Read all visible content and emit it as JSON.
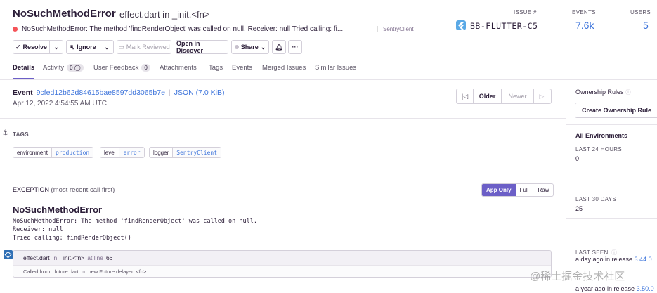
{
  "header": {
    "error_type": "NoSuchMethodError",
    "location": "effect.dart in _init.<fn>",
    "message": "NoSuchMethodError: The method 'findRenderObject' was called on null. Receiver: null Tried calling: fi...",
    "logger": "SentryClient",
    "issue_label": "ISSUE #",
    "issue_id": "BB-FLUTTER-C5",
    "events_label": "EVENTS",
    "events_value": "7.6k",
    "users_label": "USERS",
    "users_value": "5"
  },
  "toolbar": {
    "resolve": "Resolve",
    "ignore": "Ignore",
    "mark_reviewed": "Mark Reviewed",
    "open_discover": "Open in Discover",
    "share": "Share",
    "more": "···"
  },
  "tabs": [
    {
      "label": "Details"
    },
    {
      "label": "Activity",
      "count": "0"
    },
    {
      "label": "User Feedback",
      "count": "0"
    },
    {
      "label": "Attachments"
    },
    {
      "label": "Tags"
    },
    {
      "label": "Events"
    },
    {
      "label": "Merged Issues"
    },
    {
      "label": "Similar Issues"
    }
  ],
  "event": {
    "label": "Event",
    "id": "9cfed12b62d84615bae8597dd3065b7e",
    "json": "JSON (7.0 KiB)",
    "date": "Apr 12, 2022 4:54:55 AM UTC",
    "older": "Older",
    "newer": "Newer"
  },
  "tags_section": {
    "title": "TAGS",
    "tags": [
      {
        "key": "environment",
        "value": "production"
      },
      {
        "key": "level",
        "value": "error"
      },
      {
        "key": "logger",
        "value": "SentryClient"
      }
    ]
  },
  "exception": {
    "title": "EXCEPTION",
    "subtitle": "(most recent call first)",
    "app_only": "App Only",
    "full": "Full",
    "raw": "Raw",
    "type": "NoSuchMethodError",
    "lines": [
      "NoSuchMethodError: The method 'findRenderObject' was called on null.",
      "Receiver: null",
      "Tried calling: findRenderObject()"
    ],
    "frame": {
      "file": "effect.dart",
      "in": "in",
      "function": "_init.<fn>",
      "at_line": "at line",
      "line": "66",
      "called_from_label": "Called from:",
      "called_from_file": "future.dart",
      "called_from_function": "new Future.delayed.<fn>"
    }
  },
  "sidebar": {
    "ownership_title": "Ownership Rules",
    "create_rule": "Create Ownership Rule",
    "environments": "All Environments",
    "last24_label": "LAST 24 HOURS",
    "last24_value": "0",
    "last30_label": "LAST 30 DAYS",
    "last30_value": "25",
    "last_seen_label": "LAST SEEN",
    "last_seen_text": "a day ago in release",
    "last_seen_release": "3.44.0",
    "first_seen_text": "a year ago in release",
    "first_seen_release": "3.50.0"
  },
  "watermark": "@稀土掘金技术社区",
  "colors": {
    "accent": "#6c5fc7",
    "link": "#3d74db",
    "error_dot": "#f55459"
  }
}
